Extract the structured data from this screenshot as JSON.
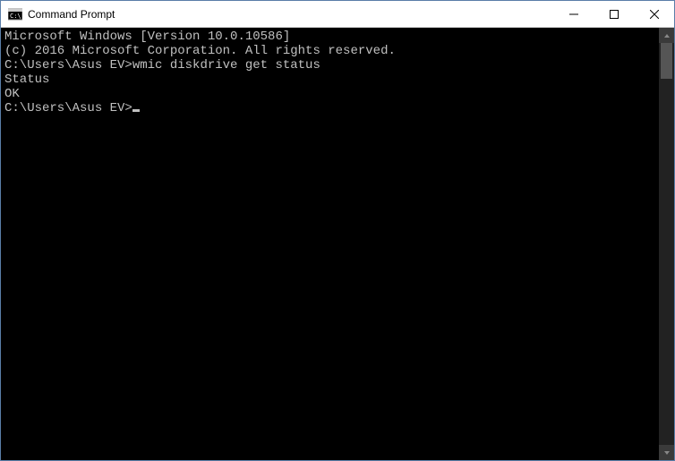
{
  "window": {
    "title": "Command Prompt"
  },
  "terminal": {
    "line1": "Microsoft Windows [Version 10.0.10586]",
    "line2": "(c) 2016 Microsoft Corporation. All rights reserved.",
    "blank1": "",
    "prompt1_path": "C:\\Users\\Asus EV>",
    "prompt1_cmd": "wmic diskdrive get status",
    "out_header": "Status",
    "out_value": "OK",
    "blank2": "",
    "blank3": "",
    "prompt2_path": "C:\\Users\\Asus EV>"
  }
}
